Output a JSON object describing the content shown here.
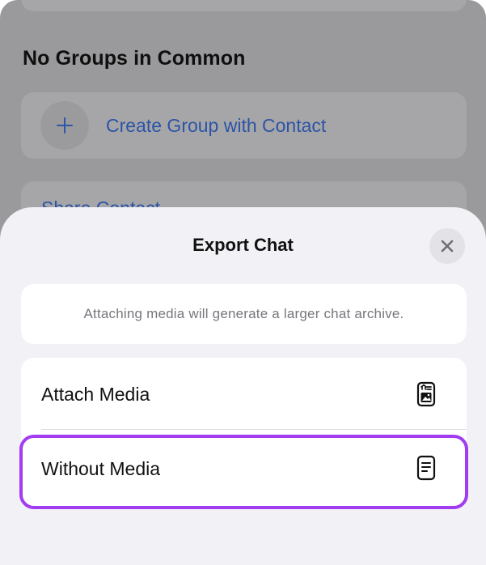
{
  "background": {
    "section_title": "No Groups in Common",
    "create_group_label": "Create Group with Contact",
    "share_contact_label": "Share Contact"
  },
  "sheet": {
    "title": "Export Chat",
    "close_icon": "close-icon",
    "info_text": "Attaching media will generate a larger chat archive.",
    "options": [
      {
        "label": "Attach Media",
        "icon": "document-with-media-icon"
      },
      {
        "label": "Without Media",
        "icon": "document-text-icon"
      }
    ]
  },
  "colors": {
    "accent_link": "#2c54a6",
    "highlight": "#a13cf0",
    "sheet_background": "#f2f1f6"
  }
}
